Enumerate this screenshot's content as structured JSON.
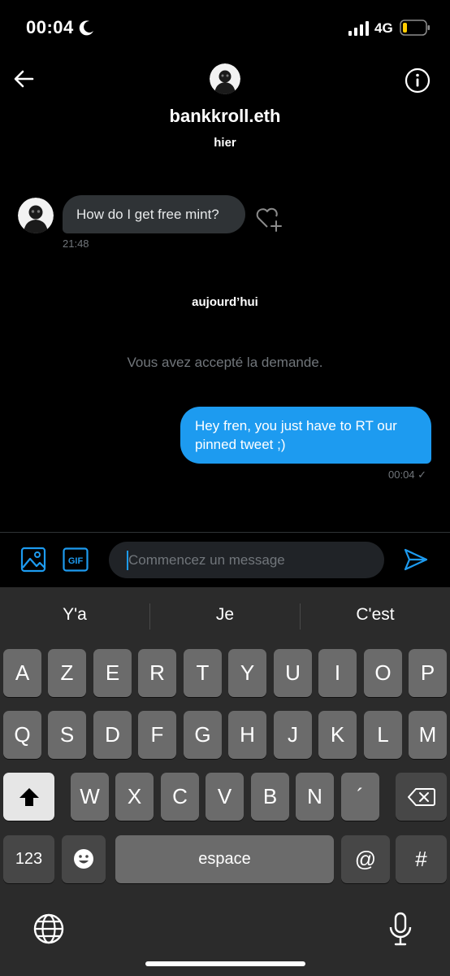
{
  "status_bar": {
    "time": "00:04",
    "network": "4G"
  },
  "header": {
    "contact_name": "bankkroll.eth",
    "last_seen_day": "hier"
  },
  "messages": {
    "incoming_text": "How do I get free mint?",
    "incoming_time": "21:48",
    "day_separator": "aujourd’hui",
    "system_note": "Vous avez accepté la demande.",
    "outgoing_text": "Hey fren, you just have to RT our pinned tweet ;)",
    "outgoing_time": "00:04 ✓"
  },
  "composer": {
    "placeholder": "Commencez un message",
    "gif_label": "GIF"
  },
  "keyboard": {
    "suggestions": [
      "Y'a",
      "Je",
      "C'est"
    ],
    "row1": [
      "A",
      "Z",
      "E",
      "R",
      "T",
      "Y",
      "U",
      "I",
      "O",
      "P"
    ],
    "row2": [
      "Q",
      "S",
      "D",
      "F",
      "G",
      "H",
      "J",
      "K",
      "L",
      "M"
    ],
    "row3": [
      "W",
      "X",
      "C",
      "V",
      "B",
      "N",
      "´"
    ],
    "numbers_label": "123",
    "space_label": "espace",
    "at_label": "@",
    "hash_label": "#"
  },
  "colors": {
    "accent": "#1d9bf0",
    "incoming_bubble": "#2f3336",
    "keyboard_bg": "#2b2b2b"
  },
  "icons": [
    "moon-icon",
    "signal-icon",
    "battery-icon",
    "back-arrow-icon",
    "info-icon",
    "heart-plus-icon",
    "image-icon",
    "gif-icon",
    "send-icon",
    "shift-icon",
    "backspace-icon",
    "emoji-icon",
    "globe-icon",
    "microphone-icon"
  ]
}
